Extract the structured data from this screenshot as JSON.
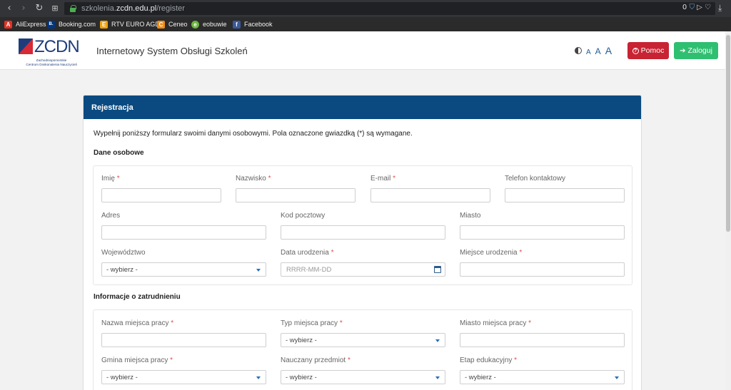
{
  "browser": {
    "url_prefix": "szkolenia.",
    "url_domain": "zcdn.edu.pl",
    "url_path": "/register",
    "right_badge": "0",
    "bookmarks": [
      {
        "label": "AliExpress",
        "color": "#e43225",
        "glyph": "A"
      },
      {
        "label": "Booking.com",
        "color": "#003580",
        "glyph": "B."
      },
      {
        "label": "RTV EURO AGD",
        "color": "#f2a20c",
        "glyph": "E"
      },
      {
        "label": "Ceneo",
        "color": "#f08c18",
        "glyph": "C"
      },
      {
        "label": "eobuwie",
        "color": "#6bb43f",
        "glyph": "e"
      },
      {
        "label": "Facebook",
        "color": "#3b5998",
        "glyph": "f"
      }
    ]
  },
  "header": {
    "logo_text": "ZCDN",
    "logo_sub_1": "Zachodniopomorskie",
    "logo_sub_2": "Centrum Doskonalenia Nauczycieli",
    "title": "Internetowy System Obsługi Szkoleń",
    "font_small": "A",
    "font_medium": "A",
    "font_large": "A",
    "help_label": "Pomoc",
    "login_label": "Zaloguj"
  },
  "card": {
    "title": "Rejestracja",
    "intro": "Wypełnij poniższy formularz swoimi danymi osobowymi. Pola oznaczone gwiazdką (*) są wymagane.",
    "personal": {
      "title": "Dane osobowe",
      "imie": "Imię",
      "nazwisko": "Nazwisko",
      "email": "E-mail",
      "telefon": "Telefon kontaktowy",
      "adres": "Adres",
      "kod": "Kod pocztowy",
      "miasto": "Miasto",
      "wojewodztwo": "Województwo",
      "wojewodztwo_value": "- wybierz -",
      "data_urodzenia": "Data urodzenia",
      "date_placeholder": "RRRR-MM-DD",
      "miejsce_urodzenia": "Miejsce urodzenia"
    },
    "employment": {
      "title": "Informacje o zatrudnieniu",
      "nazwa": "Nazwa miejsca pracy",
      "typ": "Typ miejsca pracy",
      "typ_value": "- wybierz -",
      "miasto": "Miasto miejsca pracy",
      "gmina": "Gmina miejsca pracy",
      "gmina_value": "- wybierz -",
      "przedmiot": "Nauczany przedmiot",
      "przedmiot_value": "- wybierz -",
      "etap": "Etap edukacyjny",
      "etap_value": "- wybierz -"
    },
    "required_mark": "*"
  },
  "colors": {
    "card_header": "#0a4a80",
    "help_button": "#c82333",
    "login_button": "#2fbf71",
    "required": "#d9534f"
  }
}
